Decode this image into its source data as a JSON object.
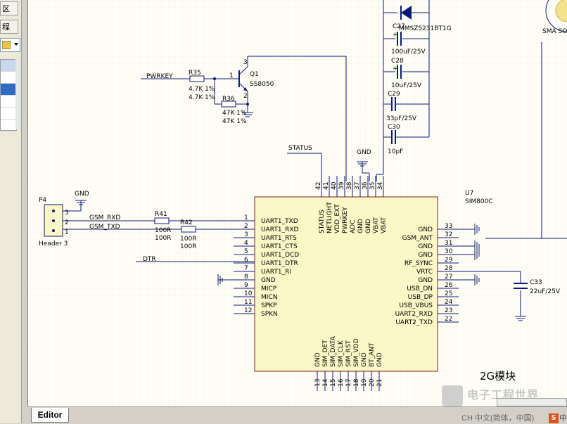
{
  "left_panel": {
    "tab_top": "区",
    "tab_2": "程"
  },
  "editor_tab": "Editor",
  "watermark": "电子工程世界",
  "ime": {
    "label": "CH 中文(简体，中国)",
    "badge": "S",
    "extra": "中"
  },
  "schematic": {
    "power": {
      "diode": "MMSZ5231BT1G",
      "caps": [
        {
          "ref": "C27",
          "value": "100uF/25V"
        },
        {
          "ref": "C28",
          "value": "10uF/25V"
        },
        {
          "ref": "C29",
          "value": "33pF/25V"
        },
        {
          "ref": "C30",
          "value": "10pF"
        }
      ]
    },
    "antenna_label": "SMA SO",
    "pwrkey_net": "PWRKEY",
    "r35": {
      "ref": "R35",
      "value": "4.7K 1%",
      "value2": "4.7K 1%"
    },
    "r36": {
      "ref": "R36",
      "value": "47K 1%",
      "value2": "47K 1%"
    },
    "q1": {
      "ref": "Q1",
      "part": "SS8050",
      "pin1": "1",
      "pin2": "2",
      "pin3": "3"
    },
    "status_net": "STATUS",
    "gnd": "GND",
    "p4": {
      "ref": "P4",
      "part": "Header 3",
      "pins": [
        "3",
        "2",
        "1"
      ]
    },
    "gsm_rxd": "GSM_RXD",
    "gsm_txd": "GSM_TXD",
    "r41": {
      "ref": "R41",
      "value": "100R",
      "value2": "100R"
    },
    "r42": {
      "ref": "R42",
      "value": "100R",
      "value2": "100R"
    },
    "dtr_net": "DTR",
    "u7": {
      "ref": "U7",
      "part": "SIM800C"
    },
    "c33": {
      "ref": "C33",
      "value": "22uF/25V"
    },
    "module_label": "2G模块",
    "left_pins": [
      {
        "num": "1",
        "name": "UART1_TXD"
      },
      {
        "num": "2",
        "name": "UART1_RXD"
      },
      {
        "num": "3",
        "name": "UART1_RTS"
      },
      {
        "num": "4",
        "name": "UART1_CTS"
      },
      {
        "num": "5",
        "name": "UART1_DCD"
      },
      {
        "num": "6",
        "name": "UART1_DTR"
      },
      {
        "num": "7",
        "name": "UART1_RI"
      },
      {
        "num": "8",
        "name": "GND"
      },
      {
        "num": "9",
        "name": "MICP"
      },
      {
        "num": "10",
        "name": "MICN"
      },
      {
        "num": "11",
        "name": "SPKP"
      },
      {
        "num": "12",
        "name": "SPKN"
      }
    ],
    "right_pins": [
      {
        "num": "33",
        "name": "GND"
      },
      {
        "num": "32",
        "name": "GSM_ANT"
      },
      {
        "num": "31",
        "name": "GND"
      },
      {
        "num": "30",
        "name": "GND"
      },
      {
        "num": "29",
        "name": "RF_SYNC"
      },
      {
        "num": "28",
        "name": "VRTC"
      },
      {
        "num": "27",
        "name": "GND"
      },
      {
        "num": "26",
        "name": "USB_DN"
      },
      {
        "num": "25",
        "name": "USB_DP"
      },
      {
        "num": "24",
        "name": "USB_VBUS"
      },
      {
        "num": "23",
        "name": "UART2_RXD"
      },
      {
        "num": "22",
        "name": "UART2_TXD"
      }
    ],
    "top_pins": [
      {
        "num": "42",
        "name": "STATUS"
      },
      {
        "num": "41",
        "name": "NETLIGHT"
      },
      {
        "num": "40",
        "name": "VDD_EXT"
      },
      {
        "num": "39",
        "name": "PWRKEY"
      },
      {
        "num": "38",
        "name": "ADC"
      },
      {
        "num": "37",
        "name": "GND"
      },
      {
        "num": "36",
        "name": "GND"
      },
      {
        "num": "35",
        "name": "VBAT"
      },
      {
        "num": "34",
        "name": "VBAT"
      }
    ],
    "bottom_pins": [
      {
        "num": "13",
        "name": "GND"
      },
      {
        "num": "14",
        "name": "SIM_DET"
      },
      {
        "num": "15",
        "name": "SIM_DATA"
      },
      {
        "num": "16",
        "name": "SIM_CLK"
      },
      {
        "num": "17",
        "name": "SIM_RST"
      },
      {
        "num": "18",
        "name": "SIM_VDD"
      },
      {
        "num": "19",
        "name": "GND"
      },
      {
        "num": "20",
        "name": "BT_ANT"
      },
      {
        "num": "21",
        "name": "GND"
      }
    ]
  }
}
